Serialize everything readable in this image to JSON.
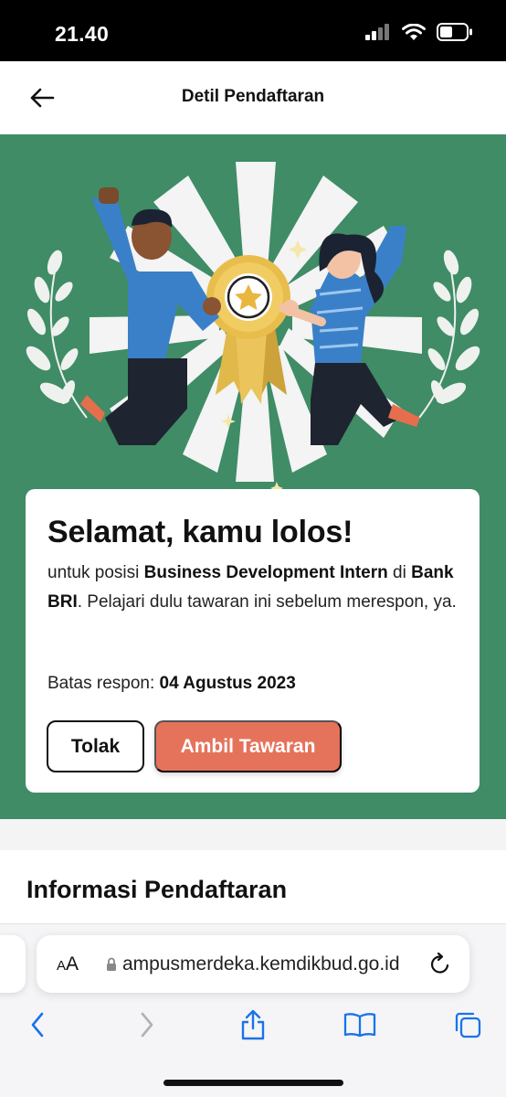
{
  "status": {
    "time": "21.40"
  },
  "header": {
    "title": "Detil Pendaftaran"
  },
  "card": {
    "headline": "Selamat, kamu lolos!",
    "desc_prefix": "untuk posisi ",
    "position": "Business Development Intern",
    "desc_mid": " di ",
    "company": "Bank BRI",
    "desc_suffix": ". Pelajari dulu tawaran ini sebelum merespon, ya.",
    "deadline_label": "Batas respon: ",
    "deadline_value": "04 Agustus 2023",
    "reject_label": "Tolak",
    "accept_label": "Ambil Tawaran"
  },
  "info": {
    "title": "Informasi Pendaftaran"
  },
  "browser": {
    "aa_label_small": "A",
    "aa_label_large": "A",
    "url": "ampusmerdeka.kemdikbud.go.id"
  },
  "colors": {
    "hero_bg": "#3f8c66",
    "accept_button": "#e5735c",
    "ios_blue": "#1a73e8"
  },
  "icons": [
    "back-arrow-icon",
    "signal-icon",
    "wifi-icon",
    "battery-icon",
    "lock-icon",
    "reload-icon",
    "chevron-left-icon",
    "chevron-right-icon",
    "share-icon",
    "bookmarks-icon",
    "tabs-icon",
    "star-icon"
  ]
}
